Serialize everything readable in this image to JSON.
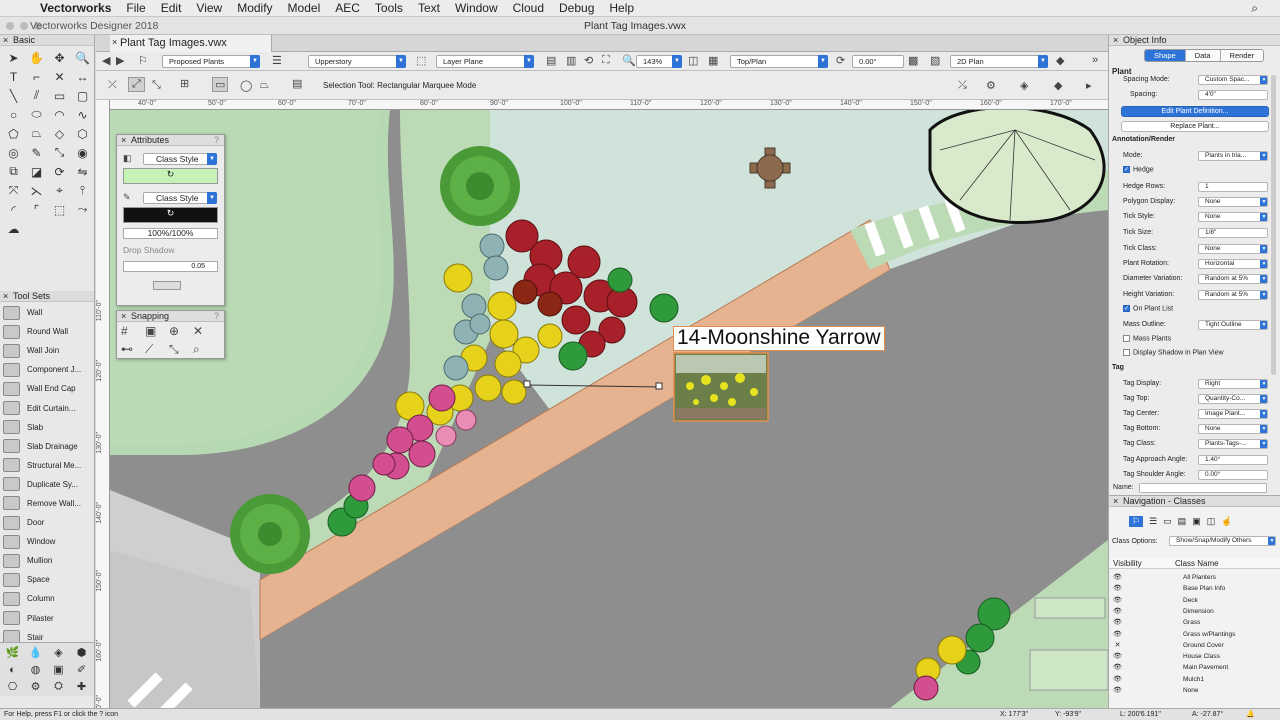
{
  "menubar": {
    "app": "Vectorworks",
    "items": [
      "File",
      "Edit",
      "View",
      "Modify",
      "Model",
      "AEC",
      "Tools",
      "Text",
      "Window",
      "Cloud",
      "Debug",
      "Help"
    ]
  },
  "window": {
    "app_title": "Vectorworks Designer 2018",
    "doc_title": "Plant Tag Images.vwx",
    "tab_label": "Plant Tag Images.vwx"
  },
  "viewbar": {
    "class": "Proposed Plants",
    "layer": "Upperstory",
    "plane": "Layer Plane",
    "zoom": "143%",
    "view": "Top/Plan",
    "rotation": "0.00°",
    "render": "2D Plan"
  },
  "toolbar": {
    "mode_label": "Selection Tool: Rectangular Marquee Mode"
  },
  "left_palette": {
    "basic_title": "Basic",
    "toolsets_title": "Tool Sets",
    "toolsets": [
      "Wall",
      "Round Wall",
      "Wall Join",
      "Component J...",
      "Wall End Cap",
      "Edit Curtain...",
      "Slab",
      "Slab Drainage",
      "Structural Me...",
      "Duplicate Sy...",
      "Remove Wall...",
      "Door",
      "Window",
      "Mullion",
      "Space",
      "Column",
      "Pilaster",
      "Stair"
    ]
  },
  "rulers": {
    "top": [
      "40'-0\"",
      "50'-0\"",
      "60'-0\"",
      "70'-0\"",
      "80'-0\"",
      "90'-0\"",
      "100'-0\"",
      "110'-0\"",
      "120'-0\"",
      "130'-0\"",
      "140'-0\"",
      "150'-0\"",
      "160'-0\"",
      "170'-0\""
    ],
    "left": [
      "100'-0\"",
      "110'-0\"",
      "120'-0\"",
      "130'-0\"",
      "140'-0\"",
      "150'-0\"",
      "160'-0\"",
      "170'-0\""
    ]
  },
  "attributes": {
    "title": "Attributes",
    "fill_style": "Class Style",
    "pen_style": "Class Style",
    "opacity": "100%/100%",
    "drop_shadow": "Drop Shadow",
    "line_weight": "0.05"
  },
  "snapping": {
    "title": "Snapping"
  },
  "plant_tag": {
    "label": "14-Moonshine Yarrow"
  },
  "object_info": {
    "title": "Object Info",
    "tabs": [
      "Shape",
      "Data",
      "Render"
    ],
    "type": "Plant",
    "spacing_mode_label": "Spacing Mode:",
    "spacing_mode": "Custom Spac...",
    "spacing_label": "Spacing:",
    "spacing": "4'0\"",
    "edit_button": "Edit Plant Definition...",
    "replace_button": "Replace Plant...",
    "annot_section": "Annotation/Render",
    "mode_label": "Mode:",
    "mode": "Plants in tria...",
    "hedge_label": "Hedge",
    "hedge_rows_label": "Hedge Rows:",
    "hedge_rows": "1",
    "polygon_display_label": "Polygon Display:",
    "polygon_display": "None",
    "tick_style_label": "Tick Style:",
    "tick_style": "None",
    "tick_size_label": "Tick Size:",
    "tick_size": "1/8\"",
    "tick_class_label": "Tick Class:",
    "tick_class": "None",
    "plant_rotation_label": "Plant Rotation:",
    "plant_rotation": "Horizontal",
    "diameter_variation_label": "Diameter Variation:",
    "diameter_variation": "Random at 5%",
    "height_variation_label": "Height Variation:",
    "height_variation": "Random at 5%",
    "on_plant_list_label": "On Plant List",
    "mass_outline_label": "Mass Outline:",
    "mass_outline": "Tight Outline",
    "mass_plants_label": "Mass Plants",
    "display_shadow_label": "Display Shadow in Plan View",
    "tag_section": "Tag",
    "tag_display_label": "Tag Display:",
    "tag_display": "Right",
    "tag_top_label": "Tag Top:",
    "tag_top": "Quantity-Co...",
    "tag_center_label": "Tag Center:",
    "tag_center": "Image Plant...",
    "tag_bottom_label": "Tag Bottom:",
    "tag_bottom": "None",
    "tag_class_label": "Tag Class:",
    "tag_class": "Plants-Tags-...",
    "tag_approach_label": "Tag Approach Angle:",
    "tag_approach": "1.40°",
    "tag_shoulder_label": "Tag Shoulder Angle:",
    "tag_shoulder": "0.00°",
    "name_label": "Name:"
  },
  "navigation": {
    "title": "Navigation - Classes",
    "class_options_label": "Class Options:",
    "class_options": "Show/Snap/Modify Others",
    "col_visibility": "Visibility",
    "col_name": "Class Name",
    "rows": [
      {
        "vis": "👁",
        "name": "All Planters"
      },
      {
        "vis": "👁",
        "name": "Base Plan Info"
      },
      {
        "vis": "👁",
        "name": "Deck"
      },
      {
        "vis": "👁",
        "name": "Dimension"
      },
      {
        "vis": "👁",
        "name": "Grass"
      },
      {
        "vis": "👁",
        "name": "Grass w/Plantings"
      },
      {
        "vis": "✕",
        "name": "Ground Cover"
      },
      {
        "vis": "👁",
        "name": "House Class"
      },
      {
        "vis": "👁",
        "name": "Main Pavement"
      },
      {
        "vis": "👁",
        "name": "Mulch1"
      },
      {
        "vis": "👁",
        "name": "None"
      }
    ]
  },
  "status": {
    "help": "For Help, press F1 or click the ? icon",
    "x": "X: 177'3\"",
    "y": "Y: -93'9\"",
    "l": "L: 200'6.191\"",
    "a": "A: -27.87°"
  }
}
